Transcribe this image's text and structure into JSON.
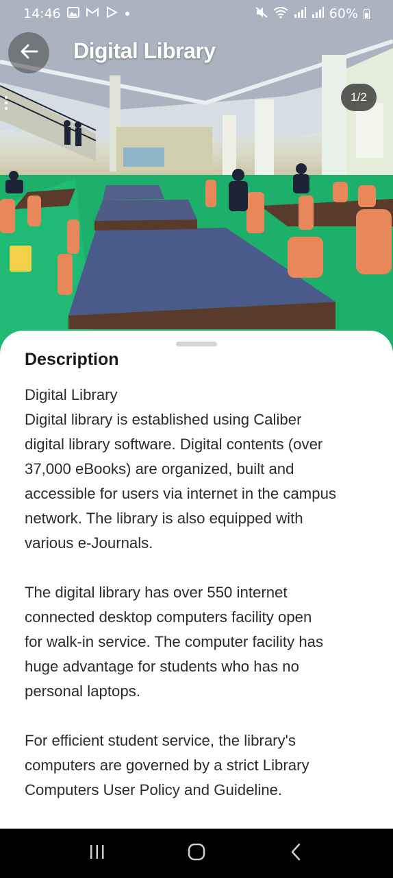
{
  "status_bar": {
    "time": "14:46",
    "battery": "60%",
    "left_icons": [
      "gallery-icon",
      "gmail-icon",
      "play-store-icon",
      "notification-dot"
    ],
    "right_icons": [
      "mute-icon",
      "wifi-icon",
      "signal-icon",
      "signal-icon",
      "battery-icon"
    ]
  },
  "app_bar": {
    "title": "Digital Library",
    "back_icon": "arrow-left-icon"
  },
  "gallery": {
    "counter": "1/2"
  },
  "description": {
    "heading": "Description",
    "lines_p1": [
      "Digital Library",
      "Digital library is established using Caliber",
      "digital library software. Digital contents (over",
      "37,000 eBooks) are organized, built and",
      "accessible for users via internet in the campus",
      "network. The library is also equipped with",
      "various e-Journals."
    ],
    "lines_p2": [
      "The digital library has over 550 internet",
      "connected desktop computers facility open",
      "for walk-in service. The computer facility has",
      "huge advantage for students who has no",
      "personal laptops."
    ],
    "lines_p3": [
      "For efficient student service, the library's",
      "computers are governed by a strict Library",
      "Computers User Policy and Guideline."
    ]
  },
  "nav_bar": {
    "buttons": [
      "recents-icon",
      "home-icon",
      "back-icon"
    ]
  },
  "colors": {
    "sheet_bg": "#ffffff",
    "floor_green": "#19b267",
    "text": "#2b2b2b"
  }
}
